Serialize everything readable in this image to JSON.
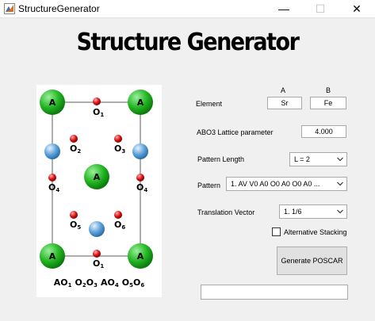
{
  "window": {
    "title": "StructureGenerator",
    "minimize_glyph": "—",
    "maximize_glyph": "☐",
    "close_glyph": "✕"
  },
  "app_title": "Structure Generator",
  "element": {
    "label": "Element",
    "col_a": "A",
    "col_b": "B",
    "a_value": "Sr",
    "b_value": "Fe"
  },
  "lattice": {
    "label": "ABO3 Lattice parameter",
    "value": "4.000"
  },
  "pattern_length": {
    "label": "Pattern Length",
    "value": "L = 2"
  },
  "pattern": {
    "label": "Pattern",
    "value": "1. AV V0 A0 O0 A0 O0 A0 ..."
  },
  "translation": {
    "label": "Translation Vector",
    "value": "1. 1/6"
  },
  "alt_stacking": {
    "label": "Alternative Stacking",
    "checked": false
  },
  "generate_button": "Generate POSCAR",
  "status_text": "",
  "structure_figure": {
    "atom_a": "A",
    "oxygen": "O",
    "labels": {
      "o1": "1",
      "o2": "2",
      "o3": "3",
      "o4": "4",
      "o5": "5",
      "o6": "6"
    },
    "caption": [
      {
        "base": "AO",
        "sub": "1"
      },
      {
        "base": "O",
        "sub": "2"
      },
      {
        "base": "O",
        "sub": "3"
      },
      {
        "base": "AO",
        "sub": "4"
      },
      {
        "base": "O",
        "sub": "5"
      },
      {
        "base": "O",
        "sub": "6"
      }
    ],
    "colors": {
      "a_site": "#22b522",
      "b_site": "#5aa0d8",
      "oxygen": "#d81010"
    }
  }
}
